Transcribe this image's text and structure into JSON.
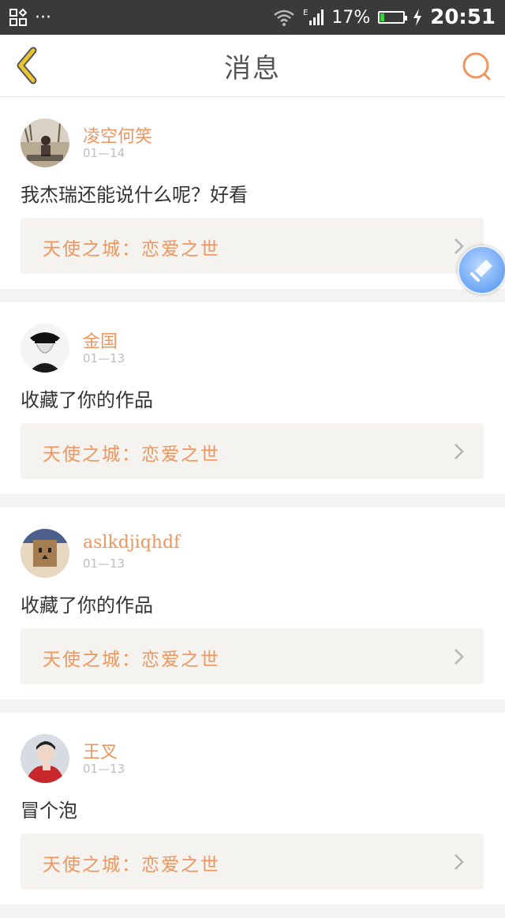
{
  "status_bar": {
    "left_dots": "···",
    "network_type": "E",
    "battery_percent": "17%",
    "battery_level": 0.17,
    "time": "20:51"
  },
  "header": {
    "title": "消息"
  },
  "messages": [
    {
      "username": "凌空何笑",
      "date": "01—14",
      "text": "我杰瑞还能说什么呢？好看",
      "work": "天使之城：恋爱之世"
    },
    {
      "username": "金国",
      "date": "01—13",
      "text": "收藏了你的作品",
      "work": "天使之城：恋爱之世"
    },
    {
      "username": "aslkdjiqhdf",
      "date": "01—13",
      "text": "收藏了你的作品",
      "work": "天使之城：恋爱之世"
    },
    {
      "username": "王叉",
      "date": "01—13",
      "text": "冒个泡",
      "work": "天使之城：恋爱之世"
    }
  ],
  "icons": {
    "back": "chevron-left-icon",
    "search": "search-icon",
    "row_chevron": "chevron-right-icon",
    "floating": "assistive-touch-icon"
  },
  "colors": {
    "accent_orange": "#f0955e",
    "back_arrow_yellow": "#e9c531",
    "status_bar": "#3a3a3a",
    "background": "#f3f3f3"
  }
}
